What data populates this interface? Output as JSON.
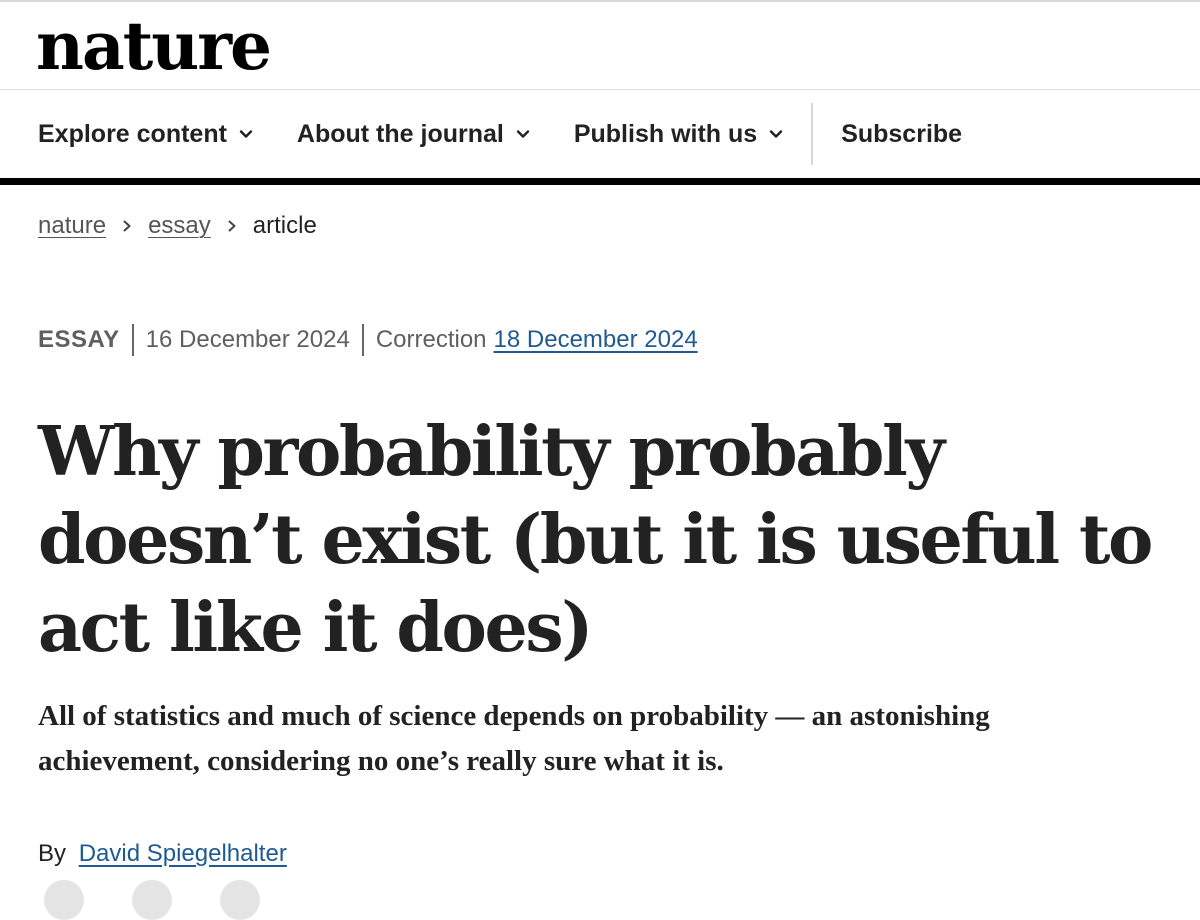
{
  "header": {
    "logo_text": "nature"
  },
  "nav": {
    "items": [
      {
        "label": "Explore content",
        "has_dropdown": true
      },
      {
        "label": "About the journal",
        "has_dropdown": true
      },
      {
        "label": "Publish with us",
        "has_dropdown": true
      }
    ],
    "subscribe_label": "Subscribe"
  },
  "breadcrumb": {
    "items": [
      "nature",
      "essay",
      "article"
    ]
  },
  "article": {
    "type": "ESSAY",
    "published_date": "16 December 2024",
    "correction_label": "Correction",
    "correction_date": "18 December 2024",
    "title": "Why probability probably doesn’t exist (but it is useful to act like it does)",
    "standfirst": "All of statistics and much of science depends on probability — an astonishing achievement, considering no one’s really sure what it is.",
    "byline_prefix": "By",
    "author": "David Spiegelhalter"
  },
  "colors": {
    "link": "#1f5a92",
    "text": "#222222",
    "meta": "#5f5f5f",
    "rule": "#000000"
  }
}
